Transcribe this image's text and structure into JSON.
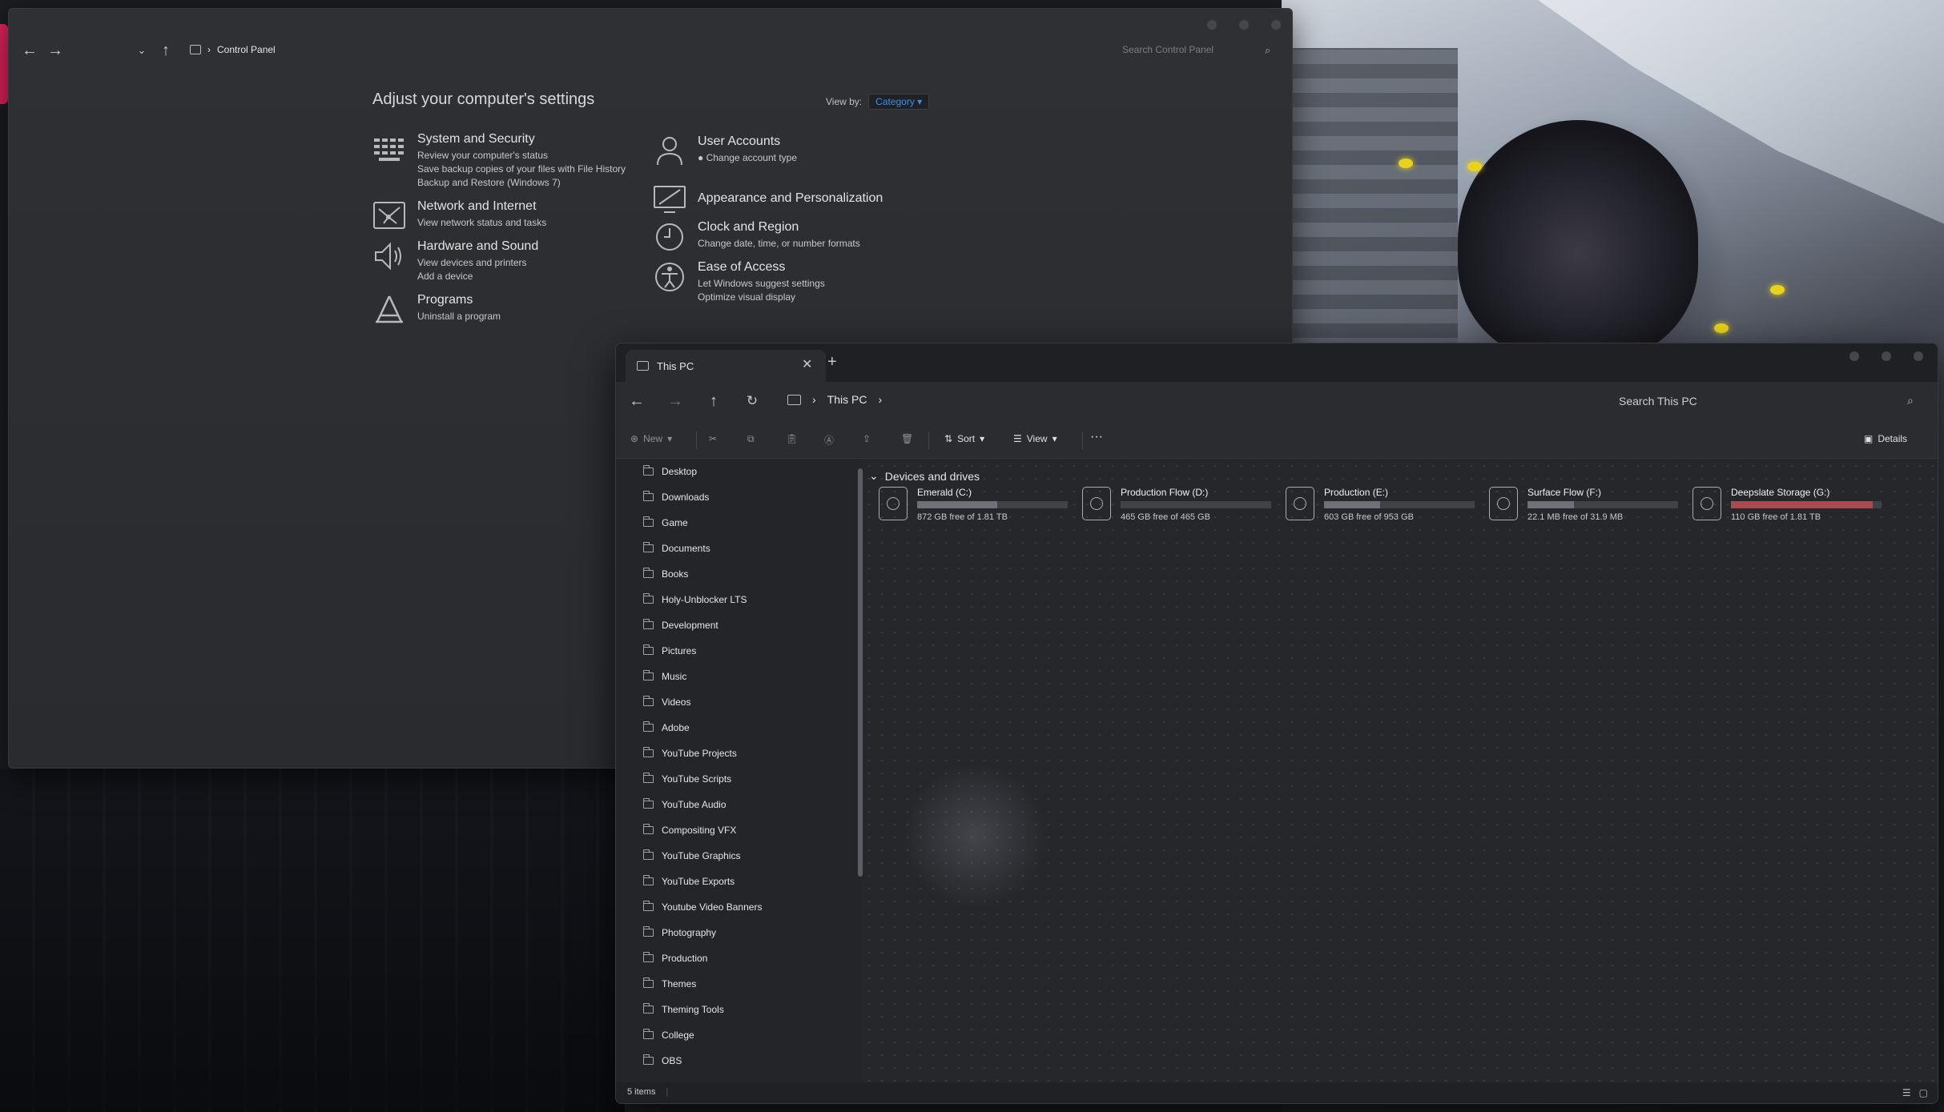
{
  "control_panel": {
    "breadcrumb": "Control Panel",
    "search_placeholder": "Search Control Panel",
    "heading": "Adjust your computer's settings",
    "view_by_label": "View by:",
    "view_by_value": "Category",
    "categories": [
      {
        "title": "System and Security",
        "links": [
          "Review your computer's status",
          "Save backup copies of your files with File History",
          "Backup and Restore (Windows 7)"
        ]
      },
      {
        "title": "Network and Internet",
        "links": [
          "View network status and tasks"
        ]
      },
      {
        "title": "Hardware and Sound",
        "links": [
          "View devices and printers",
          "Add a device"
        ]
      },
      {
        "title": "Programs",
        "links": [
          "Uninstall a program"
        ]
      },
      {
        "title": "User Accounts",
        "links": [
          "Change account type"
        ]
      },
      {
        "title": "Appearance and Personalization",
        "links": []
      },
      {
        "title": "Clock and Region",
        "links": [
          "Change date, time, or number formats"
        ]
      },
      {
        "title": "Ease of Access",
        "links": [
          "Let Windows suggest settings",
          "Optimize visual display"
        ]
      }
    ]
  },
  "explorer": {
    "tab_title": "This PC",
    "breadcrumb": "This PC",
    "search_placeholder": "Search This PC",
    "toolbar": {
      "new": "New",
      "sort": "Sort",
      "view": "View",
      "more": "···",
      "details": "Details"
    },
    "sidebar": [
      "Desktop",
      "Downloads",
      "Game",
      "Documents",
      "Books",
      "Holy-Unblocker LTS",
      "Development",
      "Pictures",
      "Music",
      "Videos",
      "Adobe",
      "YouTube Projects",
      "YouTube Scripts",
      "YouTube Audio",
      "Compositing VFX",
      "YouTube Graphics",
      "YouTube Exports",
      "Youtube Video Banners",
      "Photography",
      "Production",
      "Themes",
      "Theming Tools",
      "College",
      "OBS"
    ],
    "section_title": "Devices and drives",
    "drives": [
      {
        "name": "Emerald (C:)",
        "free": "872 GB free of 1.81 TB",
        "used_fraction": 0.53,
        "full": false
      },
      {
        "name": "Production Flow (D:)",
        "free": "465 GB free of 465 GB",
        "used_fraction": 0.0,
        "full": false
      },
      {
        "name": "Production (E:)",
        "free": "603 GB free of 953 GB",
        "used_fraction": 0.37,
        "full": false
      },
      {
        "name": "Surface Flow (F:)",
        "free": "22.1 MB free of 31.9 MB",
        "used_fraction": 0.31,
        "full": false
      },
      {
        "name": "Deepslate Storage (G:)",
        "free": "110 GB free of 1.81 TB",
        "used_fraction": 0.94,
        "full": true
      }
    ],
    "status": "5 items"
  }
}
